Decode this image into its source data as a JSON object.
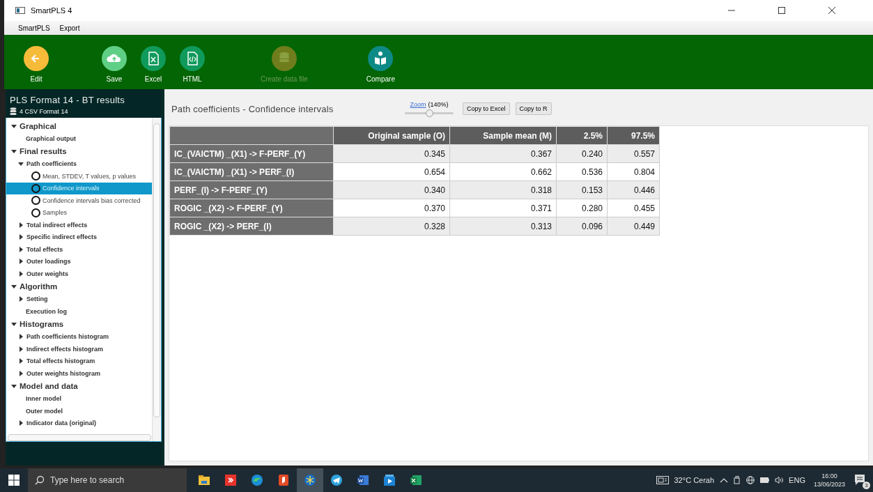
{
  "window": {
    "title": "SmartPLS 4"
  },
  "menu": [
    "SmartPLS",
    "Export"
  ],
  "toolbar": [
    {
      "label": "Edit",
      "kind": "back",
      "color": "#f7bb3a",
      "disabled": false
    },
    {
      "label": "Save",
      "kind": "cloud",
      "color": "#5fcf85",
      "disabled": false
    },
    {
      "label": "Excel",
      "kind": "excel",
      "color": "#109a5c",
      "disabled": false
    },
    {
      "label": "HTML",
      "kind": "html",
      "color": "#109a5c",
      "disabled": false
    },
    {
      "label": "Create data file",
      "kind": "database",
      "color": "#6f7d1c",
      "disabled": true
    },
    {
      "label": "Compare",
      "kind": "book",
      "color": "#0e8a86",
      "disabled": false
    }
  ],
  "sidebar": {
    "title": "PLS Format 14 - BT results",
    "dataset": "4 CSV Format 14",
    "tree": [
      {
        "label": "Graphical",
        "kind": "group",
        "expanded": true,
        "selected": false,
        "children": [
          {
            "label": "Graphical output",
            "kind": "leaf",
            "selected": false
          }
        ]
      },
      {
        "label": "Final results",
        "kind": "group",
        "expanded": true,
        "selected": false,
        "children": [
          {
            "label": "Path coefficients",
            "kind": "group",
            "expanded": true,
            "selected": false,
            "children": [
              {
                "label": "Mean, STDEV, T values, p values",
                "kind": "option",
                "selected": false
              },
              {
                "label": "Confidence intervals",
                "kind": "option",
                "selected": true
              },
              {
                "label": "Confidence intervals bias corrected",
                "kind": "option",
                "selected": false
              },
              {
                "label": "Samples",
                "kind": "option",
                "selected": false
              }
            ]
          },
          {
            "label": "Total indirect effects",
            "kind": "group",
            "expanded": false,
            "selected": false
          },
          {
            "label": "Specific indirect effects",
            "kind": "group",
            "expanded": false,
            "selected": false
          },
          {
            "label": "Total effects",
            "kind": "group",
            "expanded": false,
            "selected": false
          },
          {
            "label": "Outer loadings",
            "kind": "group",
            "expanded": false,
            "selected": false
          },
          {
            "label": "Outer weights",
            "kind": "group",
            "expanded": false,
            "selected": false
          }
        ]
      },
      {
        "label": "Algorithm",
        "kind": "group",
        "expanded": true,
        "selected": false,
        "children": [
          {
            "label": "Setting",
            "kind": "group",
            "expanded": false,
            "selected": false
          },
          {
            "label": "Execution log",
            "kind": "leaf",
            "selected": false
          }
        ]
      },
      {
        "label": "Histograms",
        "kind": "group",
        "expanded": true,
        "selected": false,
        "children": [
          {
            "label": "Path coefficients histogram",
            "kind": "group",
            "expanded": false,
            "selected": false
          },
          {
            "label": "Indirect effects histogram",
            "kind": "group",
            "expanded": false,
            "selected": false
          },
          {
            "label": "Total effects histogram",
            "kind": "group",
            "expanded": false,
            "selected": false
          },
          {
            "label": "Outer weights histogram",
            "kind": "group",
            "expanded": false,
            "selected": false
          }
        ]
      },
      {
        "label": "Model and data",
        "kind": "group",
        "expanded": true,
        "selected": false,
        "children": [
          {
            "label": "Inner model",
            "kind": "leaf",
            "selected": false
          },
          {
            "label": "Outer model",
            "kind": "leaf",
            "selected": false
          },
          {
            "label": "Indicator data (original)",
            "kind": "group",
            "expanded": false,
            "selected": false
          }
        ]
      }
    ]
  },
  "content": {
    "title": "Path coefficients - Confidence intervals",
    "zoom_link": "Zoom",
    "zoom_value": "(140%)",
    "zoom": {
      "level": 0.5
    },
    "buttons": [
      "Copy to Excel",
      "Copy to R"
    ],
    "table": {
      "columns": [
        "Original sample (O)",
        "Sample mean (M)",
        "2.5%",
        "97.5%"
      ],
      "rows": [
        {
          "label": "IC_(VAICTM) _(X1) -> F-PERF_(Y)",
          "cells": [
            "0.345",
            "0.367",
            "0.240",
            "0.557"
          ]
        },
        {
          "label": "IC_(VAICTM) _(X1) -> PERF_(I)",
          "cells": [
            "0.654",
            "0.662",
            "0.536",
            "0.804"
          ]
        },
        {
          "label": "PERF_(I) -> F-PERF_(Y)",
          "cells": [
            "0.340",
            "0.318",
            "0.153",
            "0.446"
          ]
        },
        {
          "label": "ROGIC _(X2) -> F-PERF_(Y)",
          "cells": [
            "0.370",
            "0.371",
            "0.280",
            "0.455"
          ]
        },
        {
          "label": "ROGIC _(X2) -> PERF_(I)",
          "cells": [
            "0.328",
            "0.313",
            "0.096",
            "0.449"
          ]
        }
      ]
    }
  },
  "taskbar": {
    "search_placeholder": "Type here to search",
    "apps": [
      {
        "kind": "folder",
        "selected": false
      },
      {
        "kind": "remote",
        "selected": false
      },
      {
        "kind": "browser",
        "selected": false
      },
      {
        "kind": "pdf",
        "selected": false
      },
      {
        "kind": "pls",
        "selected": true
      },
      {
        "kind": "telegram",
        "selected": false
      },
      {
        "kind": "word",
        "selected": false
      },
      {
        "kind": "video",
        "selected": false
      },
      {
        "kind": "excel",
        "selected": false
      }
    ],
    "weather": "32°C Cerah",
    "language": "ENG",
    "time": "16:00",
    "date": "13/06/2023",
    "notifications": "3"
  }
}
